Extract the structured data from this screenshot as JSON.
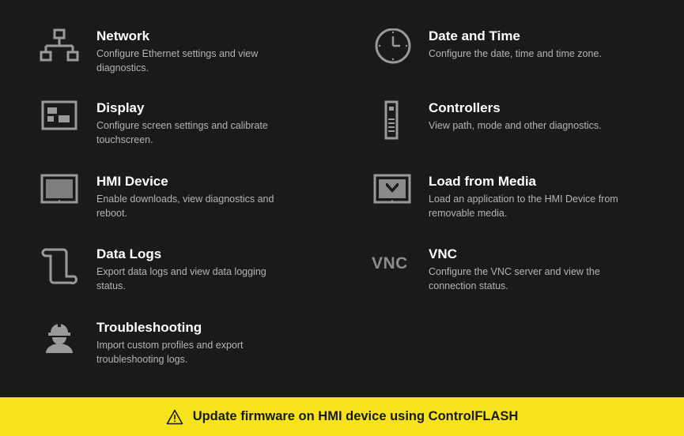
{
  "menu": {
    "network": {
      "icon": "network-icon",
      "title": "Network",
      "description": "Configure Ethernet settings and view diagnostics."
    },
    "display": {
      "icon": "display-icon",
      "title": "Display",
      "description": "Configure screen settings and calibrate touchscreen."
    },
    "hmi_device": {
      "icon": "monitor-icon",
      "title": "HMI Device",
      "description": "Enable downloads, view diagnostics and reboot."
    },
    "data_logs": {
      "icon": "scroll-icon",
      "title": "Data Logs",
      "description": "Export data logs and view data logging status."
    },
    "troubleshooting": {
      "icon": "worker-hardhat-icon",
      "title": "Troubleshooting",
      "description": "Import custom profiles and export troubleshooting logs."
    },
    "date_time": {
      "icon": "clock-icon",
      "title": "Date and Time",
      "description": "Configure the date, time and time zone."
    },
    "controllers": {
      "icon": "controller-icon",
      "title": "Controllers",
      "description": "View path, mode and other diagnostics."
    },
    "load_media": {
      "icon": "download-monitor-icon",
      "title": "Load from Media",
      "description": "Load an application to the HMI Device from removable media."
    },
    "vnc": {
      "icon": "vnc-icon",
      "icon_text": "VNC",
      "title": "VNC",
      "description": "Configure the VNC server and view the connection status."
    }
  },
  "banner": {
    "icon": "warning-icon",
    "text": "Update firmware on HMI device using ControlFLASH",
    "color": "#f7e31c"
  }
}
